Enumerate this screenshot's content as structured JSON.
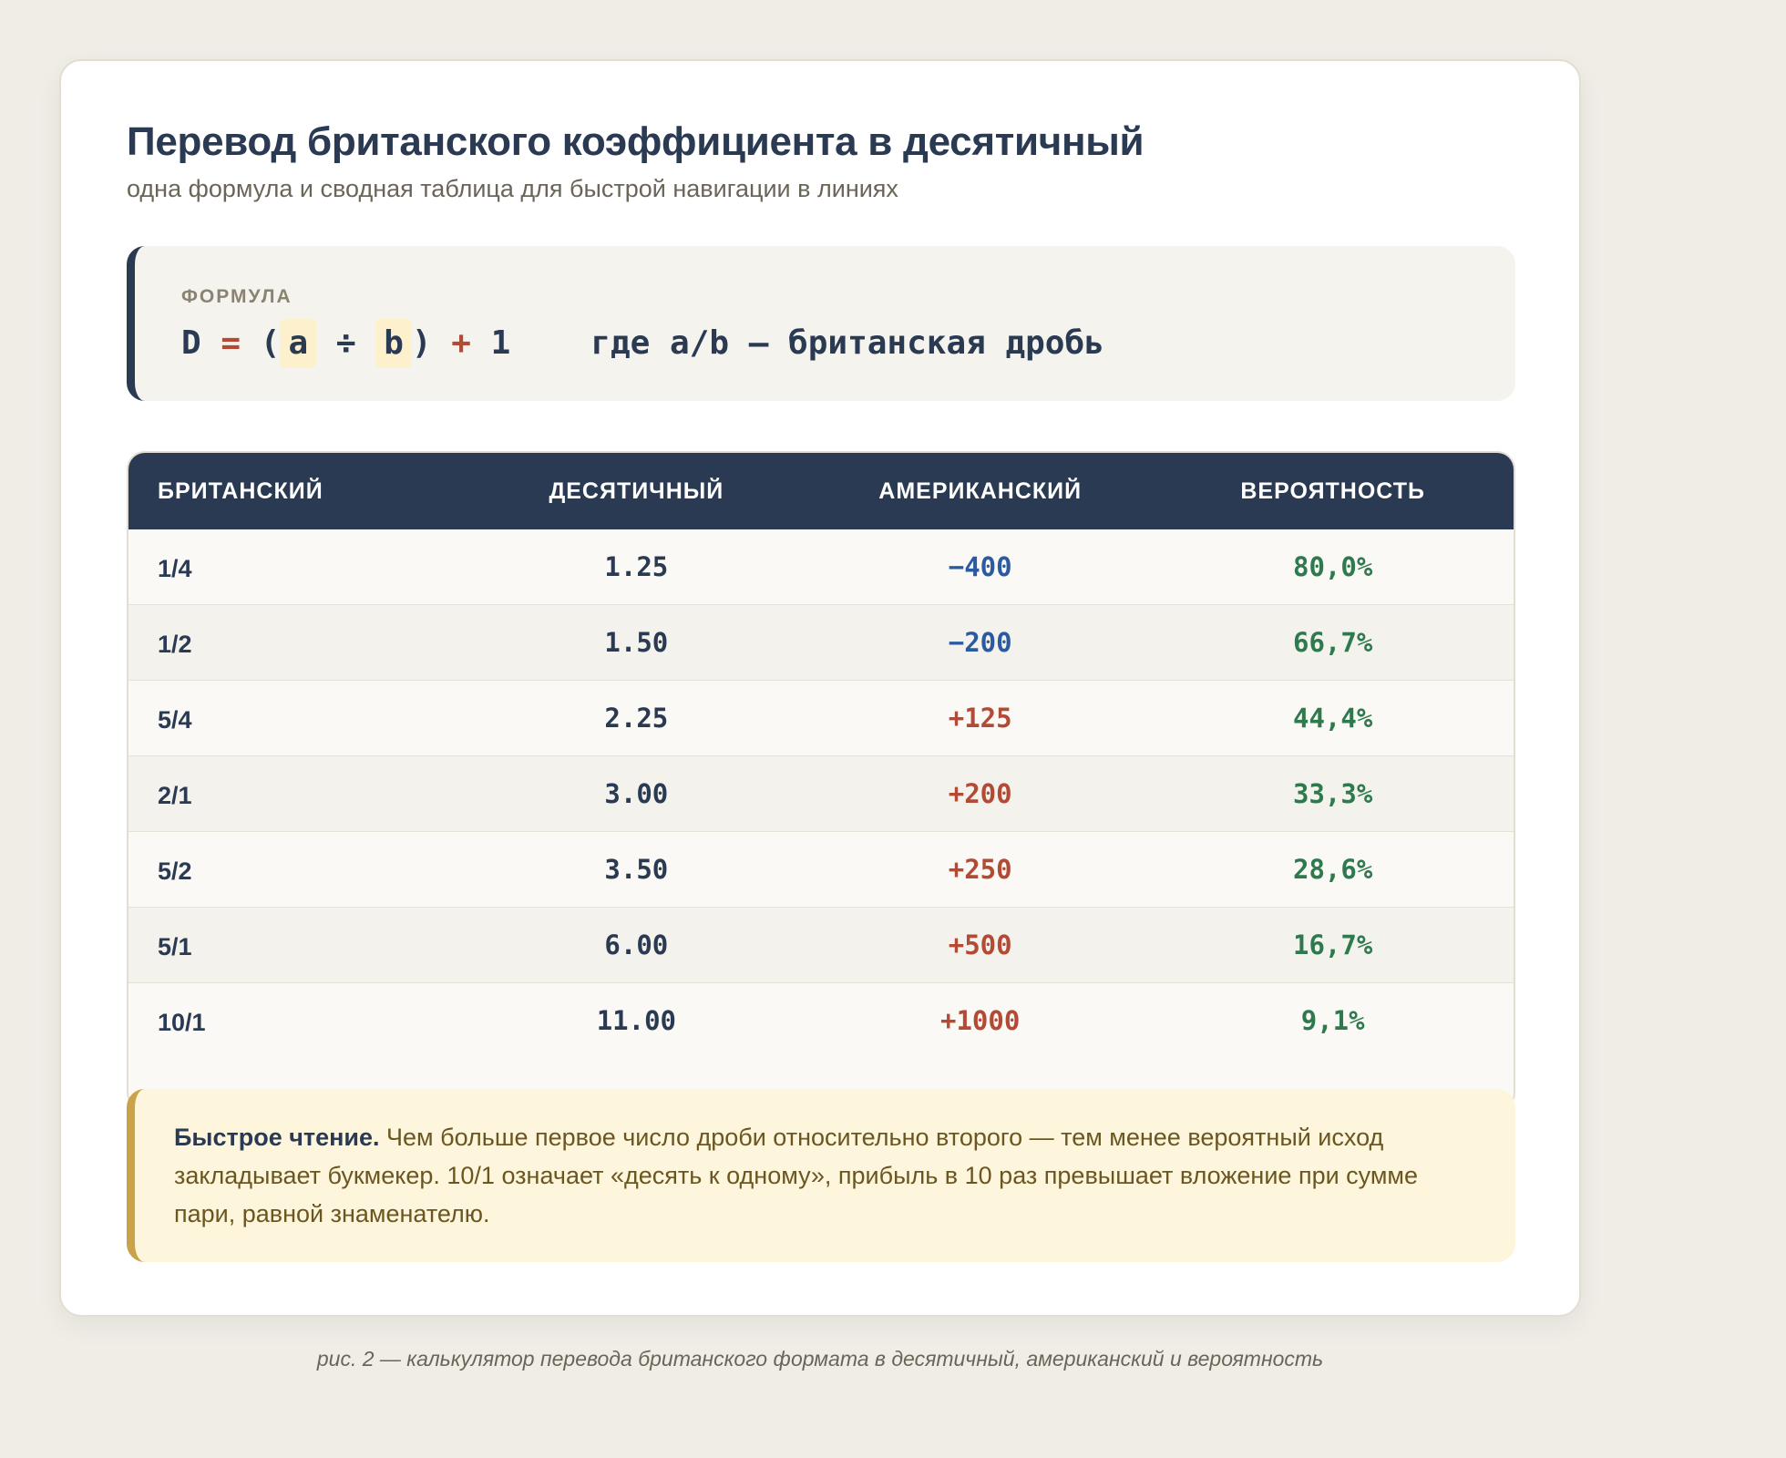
{
  "header": {
    "title": "Перевод британского коэффициента в десятичный",
    "subtitle": "одна формула и сводная таблица для быстрой навигации в линиях"
  },
  "formula": {
    "label": "ФОРМУЛА",
    "tokens": {
      "d": "D",
      "eq": "=",
      "open": "(",
      "a": "a",
      "div": "÷",
      "b": "b",
      "close": ")",
      "plus": "+",
      "one": "1"
    },
    "explanation": "где a/b — британская дробь"
  },
  "table": {
    "columns": [
      "БРИТАНСКИЙ",
      "ДЕСЯТИЧНЫЙ",
      "АМЕРИКАНСКИЙ",
      "ВЕРОЯТНОСТЬ"
    ],
    "rows": [
      {
        "fractional": "1/4",
        "decimal": "1.25",
        "american": "−400",
        "probability": "80,0%"
      },
      {
        "fractional": "1/2",
        "decimal": "1.50",
        "american": "−200",
        "probability": "66,7%"
      },
      {
        "fractional": "5/4",
        "decimal": "2.25",
        "american": "+125",
        "probability": "44,4%"
      },
      {
        "fractional": "2/1",
        "decimal": "3.00",
        "american": "+200",
        "probability": "33,3%"
      },
      {
        "fractional": "5/2",
        "decimal": "3.50",
        "american": "+250",
        "probability": "28,6%"
      },
      {
        "fractional": "5/1",
        "decimal": "6.00",
        "american": "+500",
        "probability": "16,7%"
      },
      {
        "fractional": "10/1",
        "decimal": "11.00",
        "american": "+1000",
        "probability": "9,1%"
      }
    ]
  },
  "note": {
    "lead": "Быстрое чтение.",
    "text": " Чем больше первое число дроби относительно второго — тем менее вероятный исход закладывает букмекер. 10/1 означает «десять к одному», прибыль в 10 раз превышает вложение при сумме пари, равной знаменателю."
  },
  "caption": "рис. 2 — калькулятор перевода британского формата в десятичный, американский и вероятность",
  "colors": {
    "navy": "#2a3a52",
    "negative_american": "#2c5aa0",
    "positive_american": "#b34a36",
    "probability": "#2e7a4e",
    "note_accent": "#c9a24a"
  }
}
